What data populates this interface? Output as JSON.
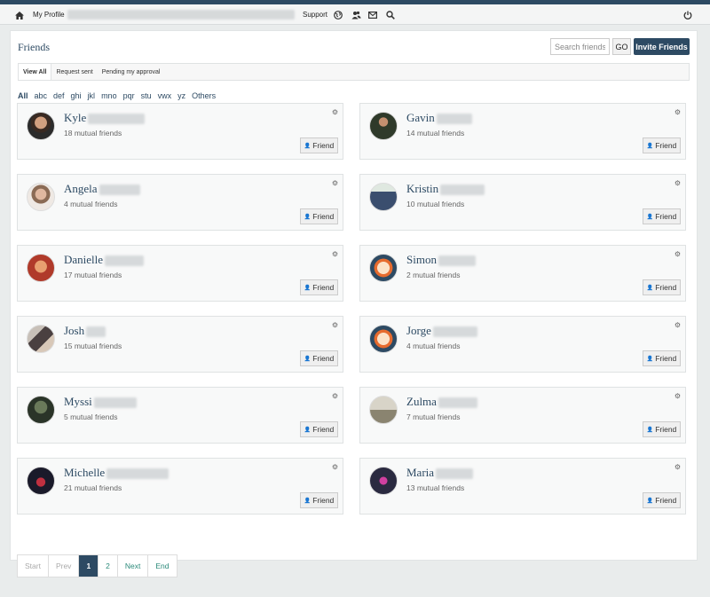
{
  "topbar": {
    "my_profile": "My Profile",
    "support": "Support",
    "icons": [
      "home-icon",
      "globe-icon",
      "users-icon",
      "mail-icon",
      "search-icon",
      "power-icon"
    ]
  },
  "page": {
    "title": "Friends",
    "search_placeholder": "Search friends",
    "go_label": "GO",
    "invite_label": "Invite Friends"
  },
  "tabs": [
    {
      "label": "View All",
      "active": true
    },
    {
      "label": "Request sent",
      "active": false
    },
    {
      "label": "Pending my approval",
      "active": false
    }
  ],
  "alpha_filters": [
    "All",
    "abc",
    "def",
    "ghi",
    "jkl",
    "mno",
    "pqr",
    "stu",
    "vwx",
    "yz",
    "Others"
  ],
  "friend_button_label": "Friend",
  "friends": [
    {
      "first": "Kyle",
      "mutual": "18 mutual friends"
    },
    {
      "first": "Gavin",
      "mutual": "14 mutual friends"
    },
    {
      "first": "Angela",
      "mutual": "4 mutual friends"
    },
    {
      "first": "Kristin",
      "mutual": "10 mutual friends"
    },
    {
      "first": "Danielle",
      "mutual": "17 mutual friends"
    },
    {
      "first": "Simon",
      "mutual": "2 mutual friends"
    },
    {
      "first": "Josh",
      "mutual": "15 mutual friends"
    },
    {
      "first": "Jorge",
      "mutual": "4 mutual friends"
    },
    {
      "first": "Myssi",
      "mutual": "5 mutual friends"
    },
    {
      "first": "Zulma",
      "mutual": "7 mutual friends"
    },
    {
      "first": "Michelle",
      "mutual": "21 mutual friends"
    },
    {
      "first": "Maria",
      "mutual": "13 mutual friends"
    }
  ],
  "pagination": {
    "start": "Start",
    "prev": "Prev",
    "page1": "1",
    "page2": "2",
    "next": "Next",
    "end": "End"
  },
  "colors": {
    "accent": "#2d4a63",
    "link": "#2b8a7a"
  }
}
